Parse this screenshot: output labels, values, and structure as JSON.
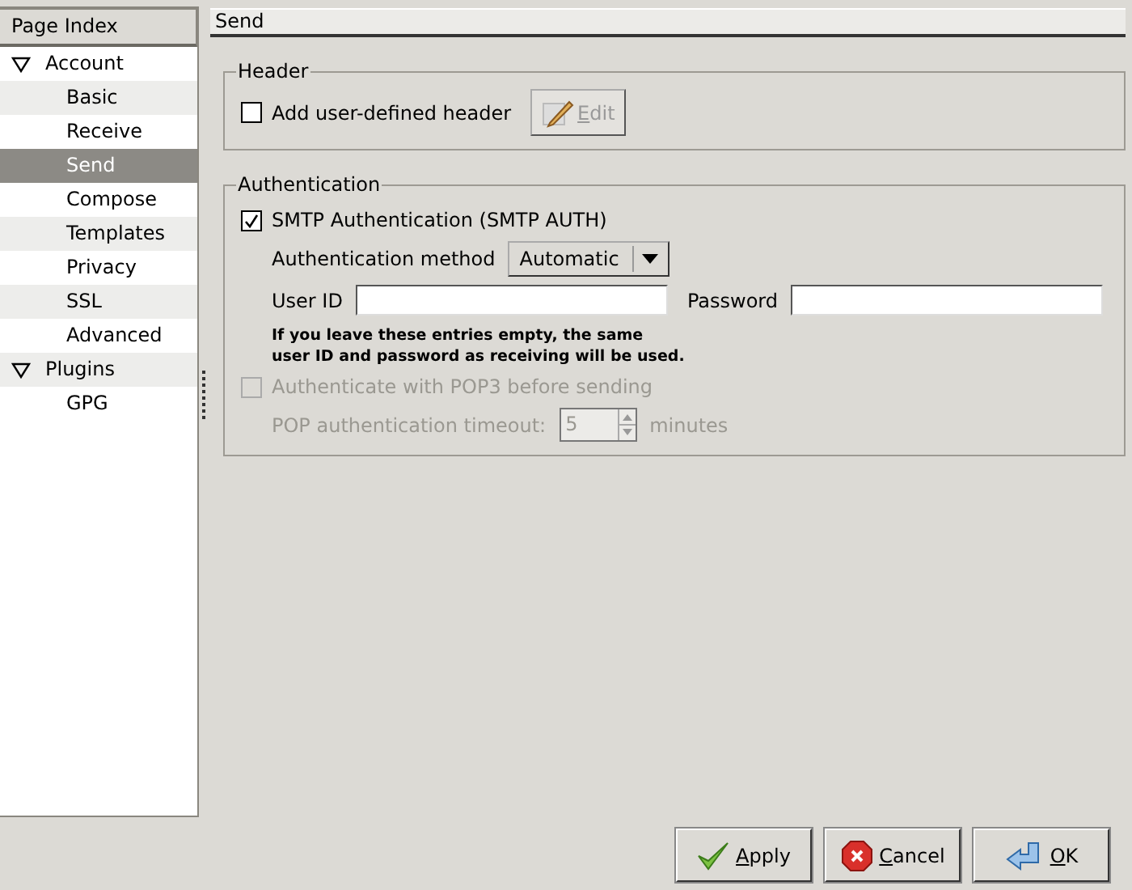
{
  "sidebar": {
    "header": "Page Index",
    "items": [
      {
        "label": "Account",
        "expanded": true,
        "selected": false,
        "children": [
          {
            "label": "Basic",
            "selected": false
          },
          {
            "label": "Receive",
            "selected": false
          },
          {
            "label": "Send",
            "selected": true
          },
          {
            "label": "Compose",
            "selected": false
          },
          {
            "label": "Templates",
            "selected": false
          },
          {
            "label": "Privacy",
            "selected": false
          },
          {
            "label": "SSL",
            "selected": false
          },
          {
            "label": "Advanced",
            "selected": false
          }
        ]
      },
      {
        "label": "Plugins",
        "expanded": true,
        "selected": false,
        "children": [
          {
            "label": "GPG",
            "selected": false
          }
        ]
      }
    ]
  },
  "page_title": "Send",
  "header_group": {
    "title": "Header",
    "checkbox": {
      "label": "Add user-defined header",
      "checked": false
    },
    "edit_button": {
      "label": "Edit",
      "disabled": true
    }
  },
  "auth_group": {
    "title": "Authentication",
    "smtp_auth": {
      "label": "SMTP Authentication (SMTP AUTH)",
      "checked": true
    },
    "method_label": "Authentication method",
    "method_value": "Automatic",
    "user_id_label": "User ID",
    "password_label": "Password",
    "hint": "If you leave these entries empty, the same\nuser ID and password as receiving will be used.",
    "pop3": {
      "label": "Authenticate with POP3 before sending",
      "checked": false,
      "disabled": true
    },
    "timeout_label": "POP authentication timeout:",
    "timeout_value": "5",
    "timeout_unit": "minutes",
    "timeout_disabled": true
  },
  "buttons": [
    {
      "label": "Apply",
      "kind": "apply"
    },
    {
      "label": "Cancel",
      "kind": "cancel"
    },
    {
      "label": "OK",
      "kind": "ok"
    }
  ]
}
